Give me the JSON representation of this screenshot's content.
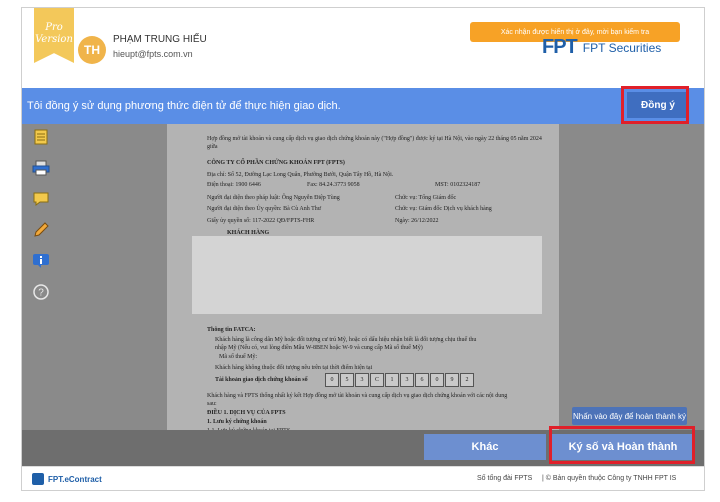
{
  "header": {
    "ribbon": "Pro Version",
    "avatar_initials": "TH",
    "user_name": "PHẠM TRUNG HIẾU",
    "user_email": "hieupt@fpts.com.vn",
    "banner": "Xác nhận được hiển thị ở đây, mời bạn kiểm tra",
    "logo_mark": "FPT",
    "logo_text": "FPT Securities"
  },
  "consent": {
    "text": "Tôi đồng ý sử dụng phương thức điện tử để thực hiện giao dịch.",
    "agree_label": "Đồng ý"
  },
  "document": {
    "intro": "Hợp đồng mở tài khoản và cung cấp dịch vụ giao dịch chứng khoán này (\"Hợp đồng\") được ký tại Hà Nội, vào ngày 22 tháng 05 năm 2024",
    "intro2": "giữa",
    "company_heading": "CÔNG TY CỔ PHẦN CHỨNG KHOÁN FPT (FPTS)",
    "address": "Địa chỉ: Số 52, Đường Lạc Long Quân, Phường Bưởi, Quận Tây Hồ, Hà Nội.",
    "phone": "Điện thoại: 1900 6446",
    "fax": "Fax: 84.24.3773 9058",
    "tax": "MST: 0102324187",
    "rep_legal": "Người đại diện theo pháp luật: Ông Nguyễn Điệp Tùng",
    "rep_legal_title": "Chức vụ: Tổng Giám đốc",
    "rep_auth": "Người đại diện theo Ủy quyền: Bà Cù Anh Thư",
    "rep_auth_title": "Chức vụ: Giám đốc Dịch vụ khách hàng",
    "auth_doc": "Giấy ủy quyền số: 117-2022 QĐ/FPTS-FHR",
    "auth_date": "Ngày: 26/12/2022",
    "customer_heading": "KHÁCH HÀNG",
    "fatca_heading": "Thông tin FATCA:",
    "fatca_1": "Khách hàng là công dân Mỹ hoặc đối tượng cư trú Mỹ, hoặc có dấu hiệu nhận biết là đối tượng chịu thuế thu",
    "fatca_1b": "nhập Mỹ (Nếu có, vui lòng điền Mẫu W-8BEN hoặc W-9 và cung cấp Mã số thuế Mỹ)",
    "fatca_tax": "Mã số thuế Mỹ:",
    "fatca_2": "Khách hàng không thuộc đối tượng nêu trên tại thời điểm hiện tại",
    "account_label": "Tài khoản giao dịch chứng khoán số",
    "account_digits": [
      "0",
      "5",
      "3",
      "C",
      "1",
      "3",
      "6",
      "0",
      "9",
      "2"
    ],
    "agree_text": "Khách hàng và FPTS thống nhất ký kết Hợp đồng mở tài khoản và cung cấp dịch vụ giao dịch chứng khoán với các nội dung",
    "agree_text2": "sau:",
    "art1": "ĐIỀU 1. DỊCH VỤ CỦA FPTS",
    "art1_1": "1.    Lưu ký chứng khoán",
    "art1_1_1": "1.1.   Lưu ký chứng khoán tại FPTS"
  },
  "tooltip": "Nhấn vào đây để hoàn thành ký",
  "actions": {
    "other_label": "Khác",
    "sign_label": "Ký số và Hoàn thành"
  },
  "footer": {
    "logo": "FPT.eContract",
    "hotline": "Số tổng đài FPTS",
    "copyright": "| © Bản quyền thuộc Công ty TNHH FPT IS"
  },
  "colors": {
    "consent_bar": "#5a8ee6",
    "action_button": "#6d8fd0",
    "highlight_box": "#e0202a",
    "ribbon": "#f3c85a"
  }
}
